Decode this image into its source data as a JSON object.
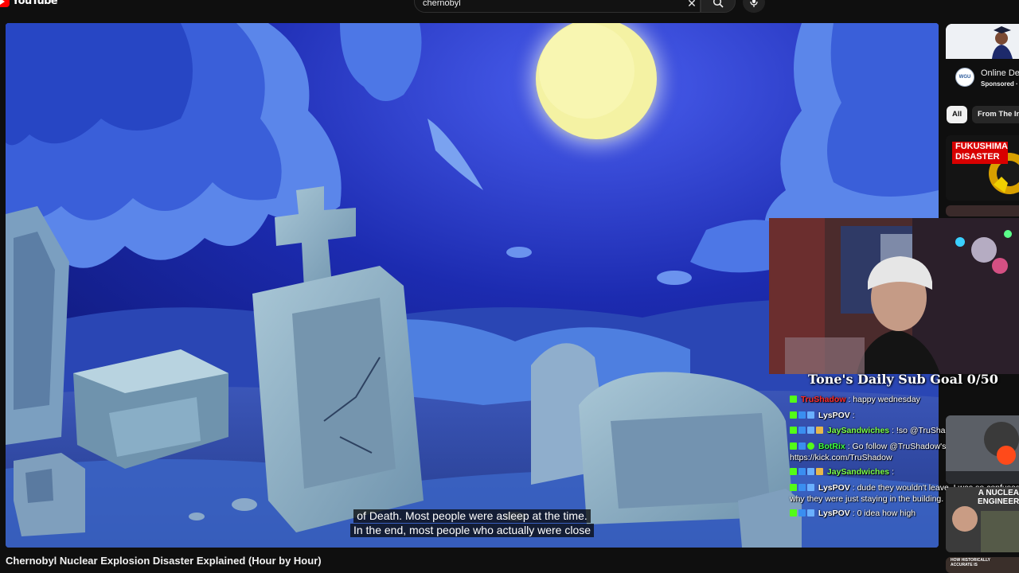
{
  "app": {
    "logo_text": "YouTube"
  },
  "search": {
    "value": "chernobyl",
    "placeholder": "Search"
  },
  "video": {
    "title": "Chernobyl Nuclear Explosion Disaster Explained (Hour by Hour)",
    "captions": [
      "of Death. Most people were asleep at the time.",
      "In the end, most people who actually were close"
    ]
  },
  "stream": {
    "sub_goal": "Tone's Daily Sub Goal 0/50",
    "chat": [
      {
        "user": "TruShadow",
        "user_color": "#ff2a2a",
        "text": ": happy wednesday"
      },
      {
        "user": "LysPOV",
        "user_color": "#ffffff",
        "text": ":"
      },
      {
        "user": "JaySandwiches",
        "user_color": "#7cff4a",
        "text": ": !so @TruShadow"
      },
      {
        "user": "BotRix",
        "user_color": "#3cff3c",
        "text": ": Go follow @TruShadow's channel -> https://kick.com/TruShadow"
      },
      {
        "user": "JaySandwiches",
        "user_color": "#7cff4a",
        "text": ":"
      },
      {
        "user": "LysPOV",
        "user_color": "#ffffff",
        "text": ": dude they wouldn't leave. I was so confused why they were just staying in the building."
      },
      {
        "user": "LysPOV",
        "user_color": "#ffffff",
        "text": ": 0 idea how high"
      }
    ]
  },
  "sidebar": {
    "ad": {
      "logo_text": "WGU",
      "title": "Online Deg",
      "sponsored": "Sponsored ·"
    },
    "chips": [
      "All",
      "From The In"
    ],
    "thumbs": [
      {
        "text_line1": "FUKUSHIMA",
        "text_line2": "DISASTER"
      },
      {
        "text_line1": "A NUCLEA",
        "text_line2": "ENGINEER"
      },
      {
        "text_line1": "HOW HISTORICALLY",
        "text_line2": "ACCURATE IS"
      }
    ]
  },
  "colors": {
    "background": "#0f0f0f",
    "accent": "#ff0000",
    "night_sky": "#1f2fa8"
  }
}
